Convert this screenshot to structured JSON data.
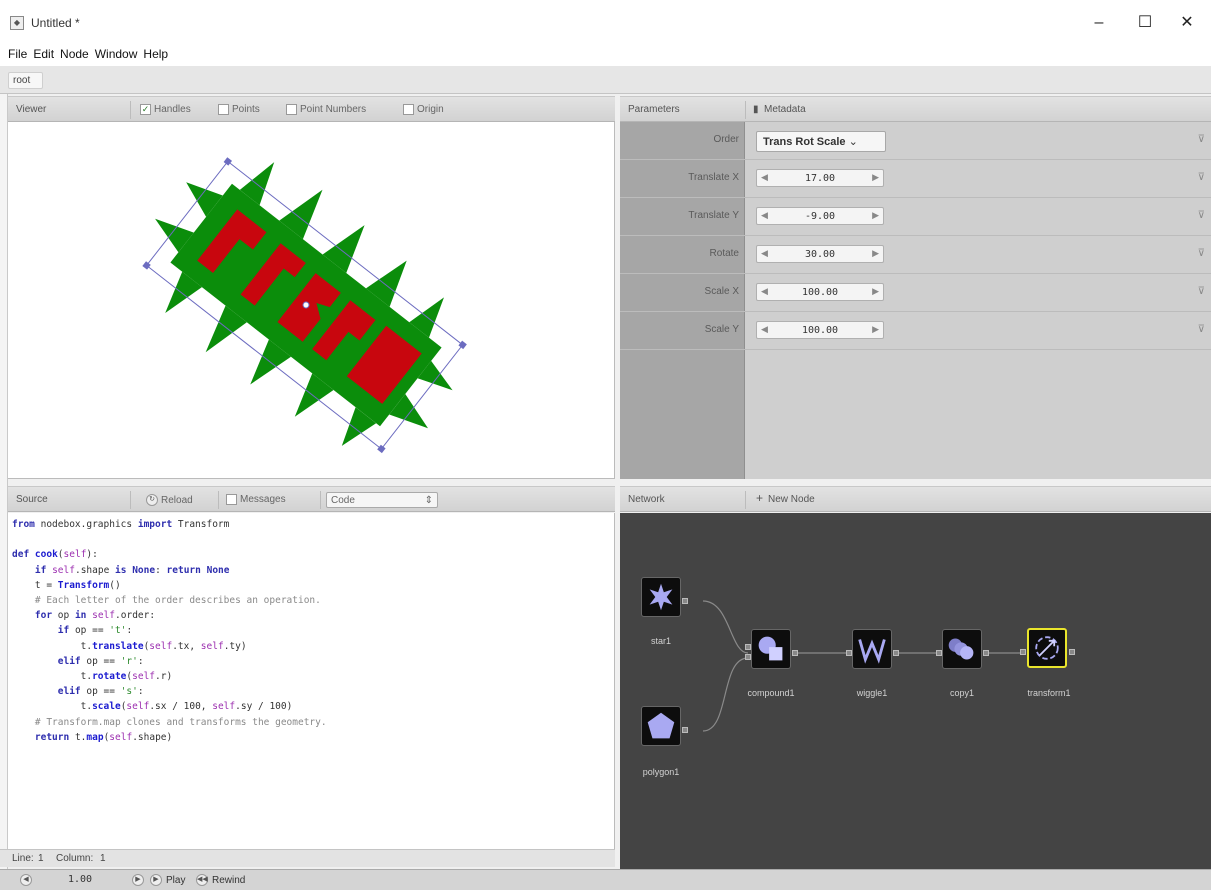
{
  "window": {
    "title": "Untitled *",
    "minimize": "–",
    "maximize": "☐",
    "close": "✕"
  },
  "menu": [
    "File",
    "Edit",
    "Node",
    "Window",
    "Help"
  ],
  "breadcrumb": "root",
  "viewer": {
    "title": "Viewer",
    "options": [
      {
        "label": "Handles",
        "checked": true
      },
      {
        "label": "Points",
        "checked": false
      },
      {
        "label": "Point Numbers",
        "checked": false
      },
      {
        "label": "Origin",
        "checked": false
      }
    ]
  },
  "parameters": {
    "tab_label": "Parameters",
    "metadata_label": "Metadata",
    "rows": [
      {
        "label": "Order",
        "value": "Trans Rot Scale"
      },
      {
        "label": "Translate X",
        "value": "17.00"
      },
      {
        "label": "Translate Y",
        "value": "-9.00"
      },
      {
        "label": "Rotate",
        "value": "30.00"
      },
      {
        "label": "Scale X",
        "value": "100.00"
      },
      {
        "label": "Scale Y",
        "value": "100.00"
      }
    ],
    "select_arrow": "⌄"
  },
  "source": {
    "title": "Source",
    "reload_label": "Reload",
    "messages_label": "Messages",
    "mode_value": "Code",
    "status": {
      "line_label": "Line:",
      "line_value": "1",
      "column_label": "Column:",
      "column_value": "1"
    }
  },
  "network": {
    "title": "Network",
    "new_node_label": "New Node",
    "nodes": [
      {
        "name": "star1",
        "icon": "star-icon"
      },
      {
        "name": "polygon1",
        "icon": "polygon-icon"
      },
      {
        "name": "compound1",
        "icon": "compound-icon"
      },
      {
        "name": "wiggle1",
        "icon": "wiggle-icon"
      },
      {
        "name": "copy1",
        "icon": "copy-icon"
      },
      {
        "name": "transform1",
        "icon": "transform-icon",
        "rendered": true
      }
    ]
  },
  "playback": {
    "frame": "1.00",
    "play_label": "Play",
    "rewind_label": "Rewind"
  },
  "colors": {
    "shape_green": "#0b8d0b",
    "letter_red": "#c8060e",
    "handle_purple": "#6c6cc0",
    "network_bg": "#444444",
    "rendered_node": "#e9e52c"
  }
}
